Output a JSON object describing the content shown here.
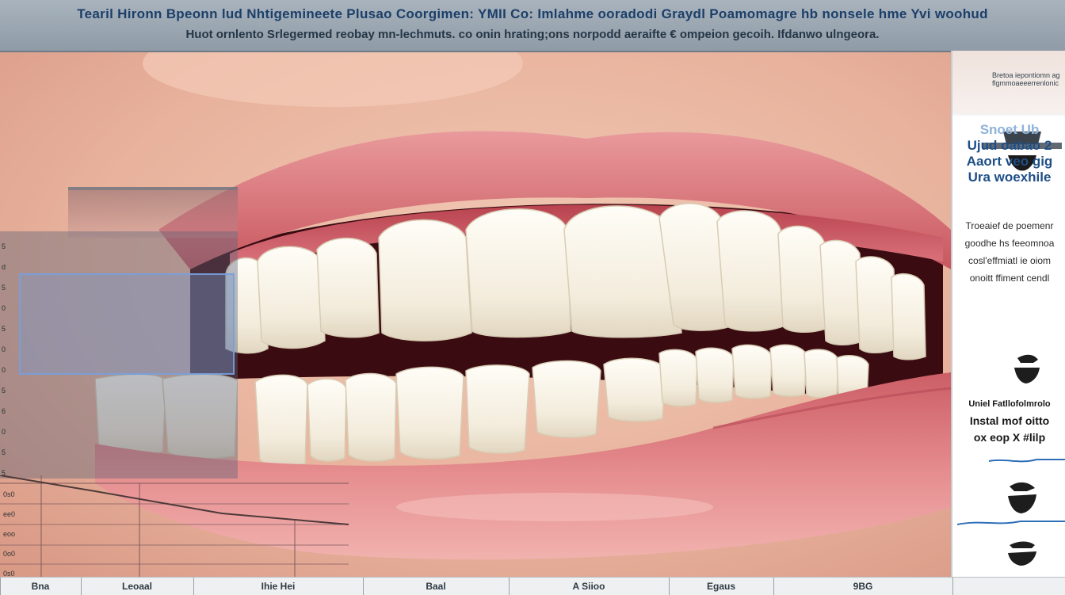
{
  "banner": {
    "line1": "Tearil Hironn Bpeonn lud Nhtigemineete Plusao Coorgimen: YMII Co: Imlahme ooradodi Graydl Poamomagre hb nonsele hme Yvi woohud",
    "line2": "Huot ornlento Srlegermed reobay mn-lechmuts. co onin hrating;ons norpodd aeraifte € ompeion gecoih. Ifdanwo ulngeora."
  },
  "side_panel": {
    "tiny_lines": [
      "Bretoa iepontiomn ag",
      "flgmmoaeeerrenlonic"
    ],
    "headline": [
      "Snoet Ub",
      "Ujud oabao 2",
      "Aaort veo gig",
      "Ura woexhile"
    ],
    "paragraph": [
      "Troeaief de poemenr",
      "goodhe hs feeomnoa",
      "cosl'effmiatl ie oiom",
      "onoitt ffiment cendl"
    ],
    "bold_block": [
      "Uniel Fatllofolmrolo",
      "Instal mof oitto",
      "ox eop X #lilp"
    ]
  },
  "bottom_strip": {
    "cells": [
      "Bna",
      "Leoaal",
      "Ihie Hei",
      "Baal",
      "A Siioo",
      "Egaus",
      "9BG",
      ""
    ]
  },
  "chart_left": {
    "ticks": [
      "5",
      "d",
      "5",
      "0",
      "5",
      "0",
      "0",
      "5",
      "6",
      "0",
      "5",
      "5"
    ],
    "bottom_ticks": [
      "0s0",
      "ee0",
      "eoo",
      "0o0",
      "0s0"
    ]
  }
}
